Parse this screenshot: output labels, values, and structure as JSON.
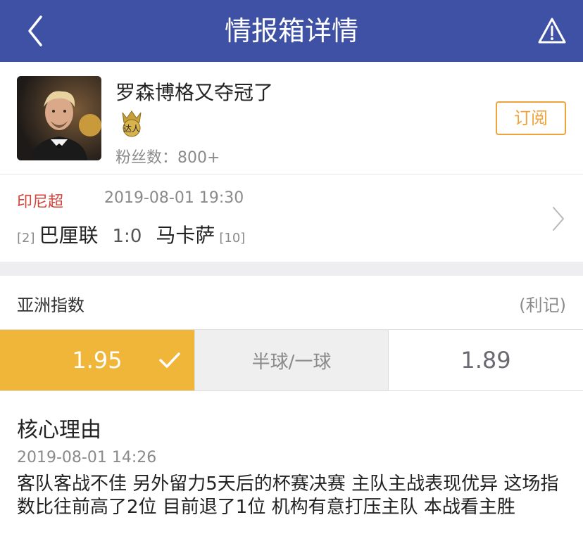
{
  "nav": {
    "title": "情报箱详情"
  },
  "user": {
    "name": "罗森博格又夺冠了",
    "badge_label": "达人",
    "fans": "粉丝数：800+",
    "subscribe_label": "订阅"
  },
  "match": {
    "league": "印尼超",
    "time": "2019-08-01 19:30",
    "home_rank": "[2]",
    "home_team": "巴厘联",
    "score": "1:0",
    "away_team": "马卡萨",
    "away_rank": "[10]"
  },
  "odds": {
    "title": "亚洲指数",
    "source": "(利记)",
    "home": "1.95",
    "handicap": "半球/一球",
    "away": "1.89",
    "selected": "home"
  },
  "reason": {
    "title": "核心理由",
    "time": "2019-08-01 14:26",
    "body": "客队客战不佳 另外留力5天后的杯赛决赛 主队主战表现优异 这场指数比往前高了2位 目前退了1位 机构有意打压主队 本战看主胜"
  },
  "colors": {
    "nav_bg": "#3f51a5",
    "accent_orange": "#f0a33b",
    "selected_odds_bg": "#f0b63a",
    "league_red": "#d0453c"
  },
  "icons": [
    "back-icon",
    "warning-icon",
    "expert-badge-icon",
    "chevron-right-icon",
    "check-icon"
  ]
}
